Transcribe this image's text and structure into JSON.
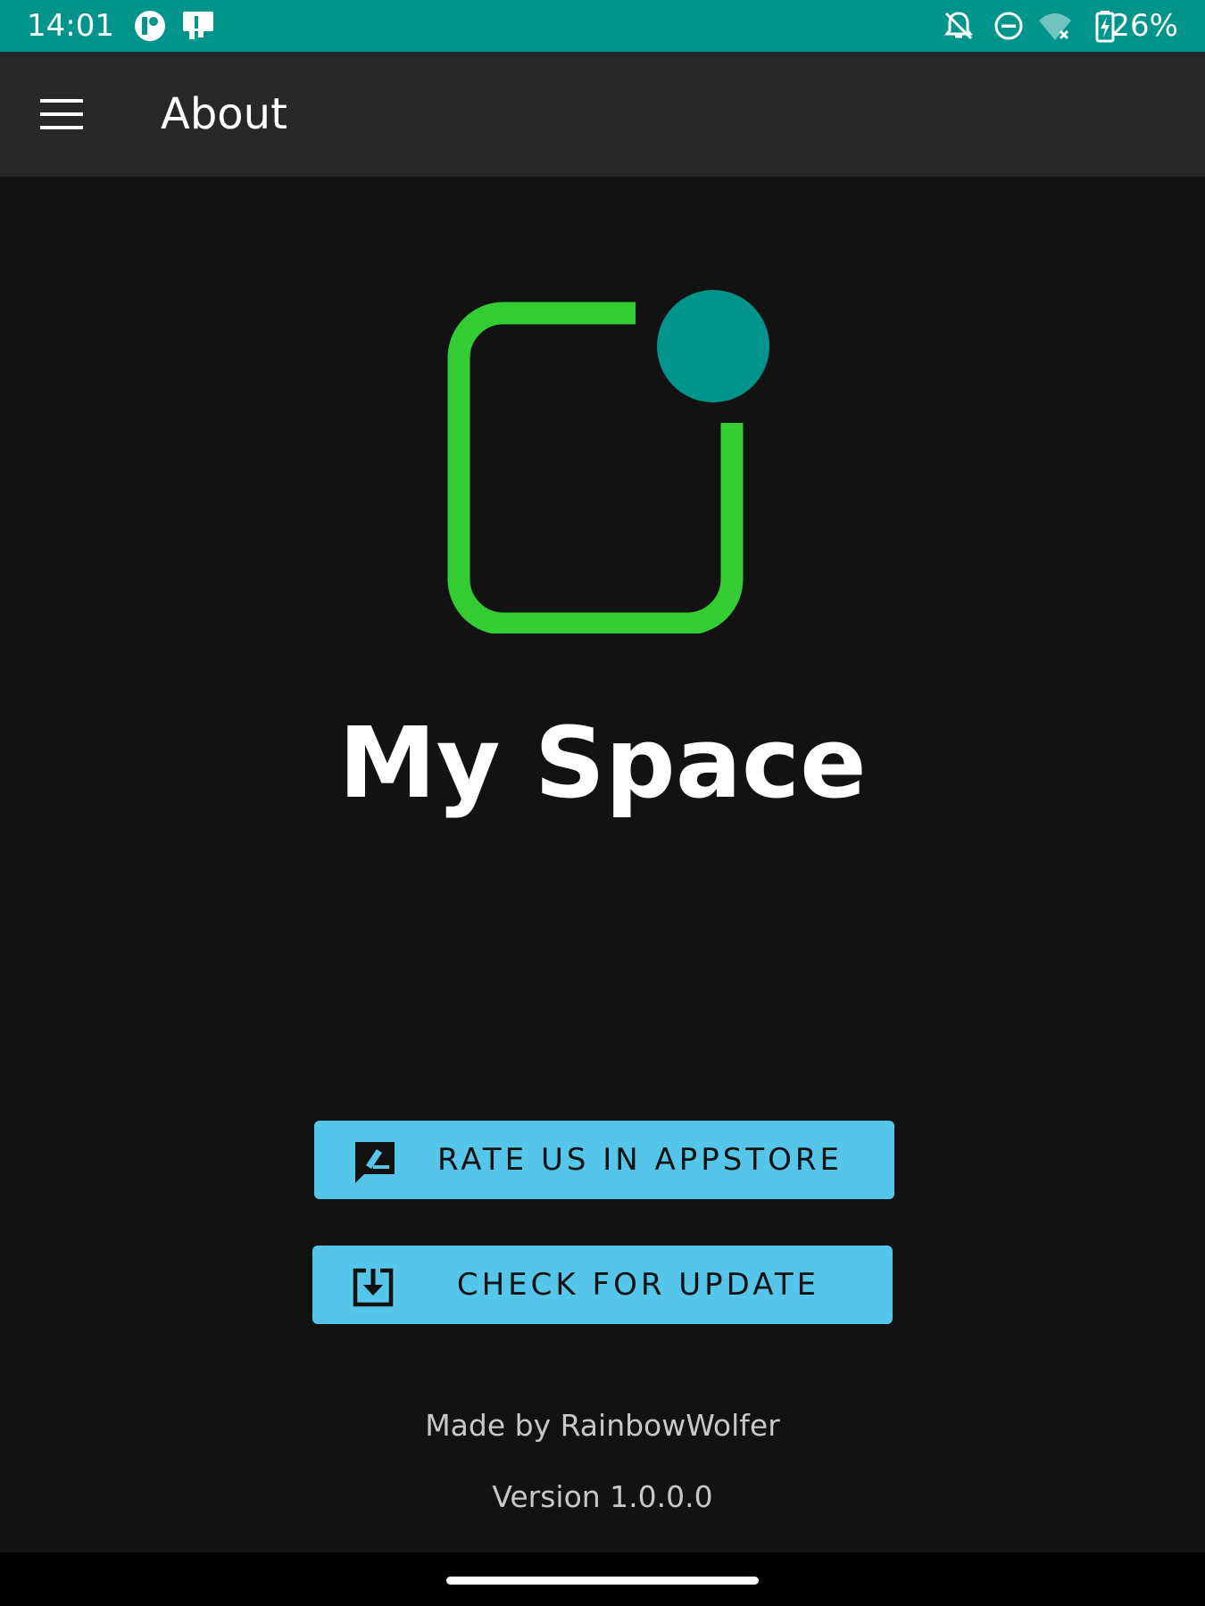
{
  "status_bar": {
    "time": "14:01",
    "battery": "26%",
    "icons": [
      "app-notification-icon",
      "sim-card-icon",
      "notifications-off-icon",
      "do-not-disturb-icon",
      "wifi-off-icon",
      "battery-charging-icon"
    ]
  },
  "app_bar": {
    "title": "About",
    "menu_icon": "menu-icon"
  },
  "logo": {
    "square_color": "#33cc33",
    "dot_color": "#00948c"
  },
  "main": {
    "app_name": "My Space",
    "buttons": [
      {
        "label": "RATE US IN APPSTORE",
        "icon": "rate-review-icon"
      },
      {
        "label": "CHECK FOR UPDATE",
        "icon": "download-icon"
      }
    ],
    "made_by": "Made by RainbowWolfer",
    "version": "Version 1.0.0.0"
  },
  "colors": {
    "status_bar": "#00948c",
    "app_bar": "#282828",
    "background": "#121212",
    "button": "#55c6ea"
  }
}
